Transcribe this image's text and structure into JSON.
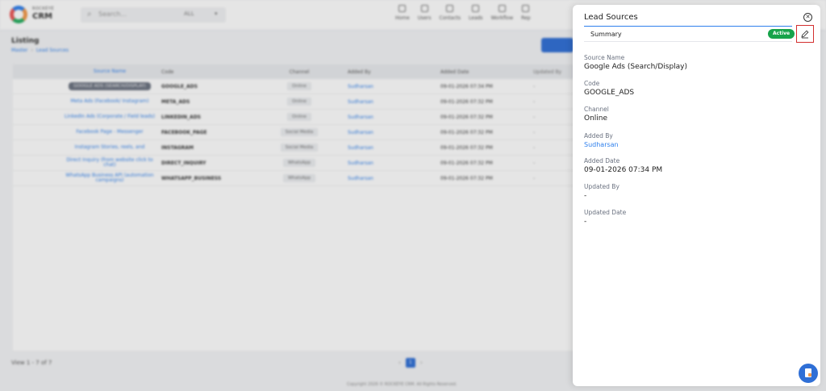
{
  "app": {
    "brand_small": "ROCKEYE",
    "brand_name": "CRM",
    "search_placeholder": "Search...",
    "search_filter": "ALL",
    "nav": [
      "Home",
      "Users",
      "Contacts",
      "Leads",
      "Workflow",
      "Rep"
    ]
  },
  "listing": {
    "title": "Listing",
    "breadcrumb": [
      "Master",
      "Lead Sources"
    ],
    "columns": [
      "Source Name",
      "Code",
      "Channel",
      "Added By",
      "Added Date",
      "Updated By"
    ],
    "rows": [
      {
        "name": "GOOGLE ADS (SEARCH/DISPLAY)",
        "code": "GOOGLE_ADS",
        "channel": "Online",
        "added_by": "Sudharsan",
        "added_date": "09-01-2026 07:34 PM",
        "updated_by": "-"
      },
      {
        "name": "Meta Ads (Facebook/ Instagram)",
        "code": "META_ADS",
        "channel": "Online",
        "added_by": "Sudharsan",
        "added_date": "09-01-2026 07:32 PM",
        "updated_by": "-"
      },
      {
        "name": "LinkedIn Ads (Corporate / Field leads)",
        "code": "LINKEDIN_ADS",
        "channel": "Online",
        "added_by": "Sudharsan",
        "added_date": "09-01-2026 07:32 PM",
        "updated_by": "-"
      },
      {
        "name": "Facebook Page - Messenger",
        "code": "FACEBOOK_PAGE",
        "channel": "Social Media",
        "added_by": "Sudharsan",
        "added_date": "09-01-2026 07:32 PM",
        "updated_by": "-"
      },
      {
        "name": "Instagram Stories, reels, and",
        "code": "INSTAGRAM",
        "channel": "Social Media",
        "added_by": "Sudharsan",
        "added_date": "09-01-2026 07:32 PM",
        "updated_by": "-"
      },
      {
        "name": "Direct Inquiry (from website click to chat)",
        "code": "DIRECT_INQUIRY",
        "channel": "WhatsApp",
        "added_by": "Sudharsan",
        "added_date": "09-01-2026 07:32 PM",
        "updated_by": "-"
      },
      {
        "name": "WhatsApp Business API (automation campaigns)",
        "code": "WHATSAPP_BUSINESS",
        "channel": "WhatsApp",
        "added_by": "Sudharsan",
        "added_date": "09-01-2026 07:32 PM",
        "updated_by": "-"
      }
    ],
    "footer_count": "View 1 - 7 of 7",
    "page": "1",
    "copyright": "Copyright 2026 © ROCKEYE CRM. All Rights Reserved."
  },
  "panel": {
    "title": "Lead Sources",
    "tab": "Summary",
    "status": "Active",
    "fields": {
      "source_name_label": "Source Name",
      "source_name": "Google Ads (Search/Display)",
      "code_label": "Code",
      "code": "GOOGLE_ADS",
      "channel_label": "Channel",
      "channel": "Online",
      "added_by_label": "Added By",
      "added_by": "Sudharsan",
      "added_date_label": "Added Date",
      "added_date": "09-01-2026 07:34 PM",
      "updated_by_label": "Updated By",
      "updated_by": "-",
      "updated_date_label": "Updated Date",
      "updated_date": "-"
    },
    "colors": {
      "accent": "#2f80ed",
      "status": "#16a34a",
      "highlight": "#d32f2f"
    }
  }
}
